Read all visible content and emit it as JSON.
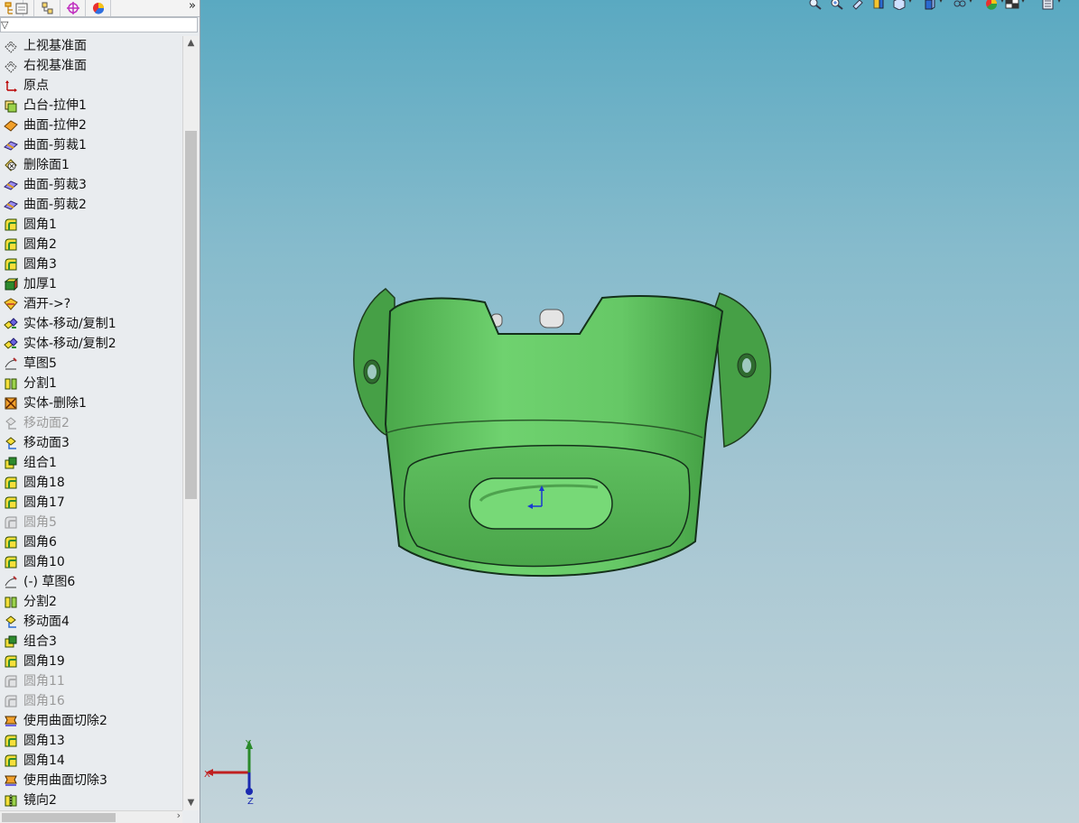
{
  "feature_manager": {
    "tabs": [
      {
        "icon": "feature-tree-icon"
      },
      {
        "icon": "property-manager-icon"
      },
      {
        "icon": "configuration-manager-icon"
      },
      {
        "icon": "dimxpert-manager-icon"
      },
      {
        "icon": "display-manager-icon"
      }
    ],
    "tabs_overflow": "»",
    "filter_icon": "▽",
    "items": [
      {
        "label": "上视基准面",
        "icon": "plane-icon",
        "suppressed": false
      },
      {
        "label": "右视基准面",
        "icon": "plane-icon",
        "suppressed": false
      },
      {
        "label": "原点",
        "icon": "origin-icon",
        "suppressed": false
      },
      {
        "label": "凸台-拉伸1",
        "icon": "boss-extrude-icon",
        "suppressed": false
      },
      {
        "label": "曲面-拉伸2",
        "icon": "surface-extrude-icon",
        "suppressed": false
      },
      {
        "label": "曲面-剪裁1",
        "icon": "surface-trim-icon",
        "suppressed": false
      },
      {
        "label": "删除面1",
        "icon": "delete-face-icon",
        "suppressed": false
      },
      {
        "label": "曲面-剪裁3",
        "icon": "surface-trim-icon",
        "suppressed": false
      },
      {
        "label": "曲面-剪裁2",
        "icon": "surface-trim-icon",
        "suppressed": false
      },
      {
        "label": "圆角1",
        "icon": "fillet-icon",
        "suppressed": false
      },
      {
        "label": "圆角2",
        "icon": "fillet-icon",
        "suppressed": false
      },
      {
        "label": "圆角3",
        "icon": "fillet-icon",
        "suppressed": false
      },
      {
        "label": "加厚1",
        "icon": "thicken-icon",
        "suppressed": false
      },
      {
        "label": "酒开->?",
        "icon": "split-line-icon",
        "suppressed": false
      },
      {
        "label": "实体-移动/复制1",
        "icon": "move-copy-body-icon",
        "suppressed": false
      },
      {
        "label": "实体-移动/复制2",
        "icon": "move-copy-body-icon",
        "suppressed": false
      },
      {
        "label": "草图5",
        "icon": "sketch-icon",
        "suppressed": false
      },
      {
        "label": "分割1",
        "icon": "split-icon",
        "suppressed": false
      },
      {
        "label": "实体-删除1",
        "icon": "delete-body-icon",
        "suppressed": false
      },
      {
        "label": "移动面2",
        "icon": "move-face-icon",
        "suppressed": true
      },
      {
        "label": "移动面3",
        "icon": "move-face-icon",
        "suppressed": false
      },
      {
        "label": "组合1",
        "icon": "combine-icon",
        "suppressed": false
      },
      {
        "label": "圆角18",
        "icon": "fillet-icon",
        "suppressed": false
      },
      {
        "label": "圆角17",
        "icon": "fillet-icon",
        "suppressed": false
      },
      {
        "label": "圆角5",
        "icon": "fillet-icon",
        "suppressed": true
      },
      {
        "label": "圆角6",
        "icon": "fillet-icon",
        "suppressed": false
      },
      {
        "label": "圆角10",
        "icon": "fillet-icon",
        "suppressed": false
      },
      {
        "label": "(-) 草图6",
        "icon": "sketch-icon",
        "suppressed": false
      },
      {
        "label": "分割2",
        "icon": "split-icon",
        "suppressed": false
      },
      {
        "label": "移动面4",
        "icon": "move-face-icon",
        "suppressed": false
      },
      {
        "label": "组合3",
        "icon": "combine-icon",
        "suppressed": false
      },
      {
        "label": "圆角19",
        "icon": "fillet-icon",
        "suppressed": false
      },
      {
        "label": "圆角11",
        "icon": "fillet-icon",
        "suppressed": true
      },
      {
        "label": "圆角16",
        "icon": "fillet-icon",
        "suppressed": true
      },
      {
        "label": "使用曲面切除2",
        "icon": "surface-cut-icon",
        "suppressed": false
      },
      {
        "label": "圆角13",
        "icon": "fillet-icon",
        "suppressed": false
      },
      {
        "label": "圆角14",
        "icon": "fillet-icon",
        "suppressed": false
      },
      {
        "label": "使用曲面切除3",
        "icon": "surface-cut-icon",
        "suppressed": false
      },
      {
        "label": "镜向2",
        "icon": "mirror-icon",
        "suppressed": false
      }
    ]
  },
  "heads_up_toolbar": [
    {
      "icon": "zoom-to-fit-icon"
    },
    {
      "icon": "zoom-to-area-icon"
    },
    {
      "icon": "previous-view-icon"
    },
    {
      "icon": "section-view-icon"
    },
    {
      "icon": "view-orientation-icon"
    },
    {
      "icon": "display-style-icon"
    },
    {
      "icon": "hide-show-items-icon"
    },
    {
      "icon": "edit-appearance-icon"
    },
    {
      "icon": "apply-scene-icon"
    },
    {
      "icon": "view-settings-icon"
    }
  ],
  "triad": {
    "x_label": "X",
    "y_label": "Y",
    "z_label": "Z"
  },
  "colors": {
    "part_green": "#66cc66",
    "part_dark_green": "#3f9a3f",
    "viewport_top": "#5aa9c1",
    "viewport_bottom": "#c3d4da",
    "panel_bg": "#e9ecef"
  }
}
